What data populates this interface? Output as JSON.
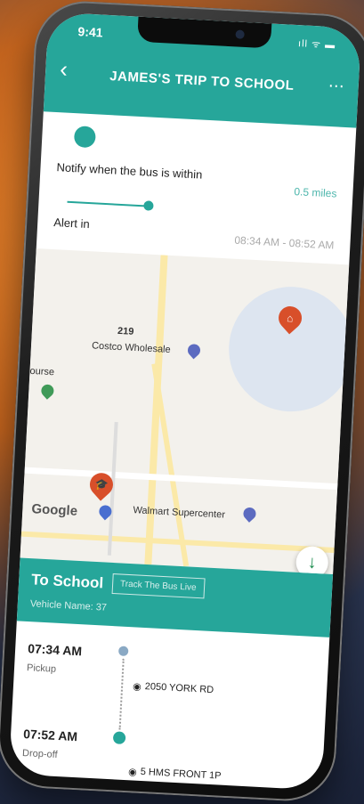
{
  "status": {
    "time": "9:41",
    "icons": "ıll ᯤ ▬"
  },
  "header": {
    "title": "JAMES'S TRIP TO SCHOOL",
    "back_icon": "back-arrow-icon",
    "more_icon": "more-icon"
  },
  "settings": {
    "notify_label": "Notify when the bus is within",
    "notify_value": "0.5 miles",
    "alert_label": "Alert in",
    "alert_value": "08:34 AM - 08:52 AM"
  },
  "map": {
    "labels": {
      "route_number": "219",
      "costco": "Costco Wholesale",
      "course": "ourse",
      "walmart": "Walmart Supercenter",
      "google": "Google"
    },
    "colors": {
      "home_pin": "#d84f2a",
      "school_pin": "#d84f2a",
      "poi": "#5c6bc0"
    }
  },
  "route": {
    "title": "To School",
    "track_button": "Track The Bus Live",
    "vehicle": "Vehicle Name: 37"
  },
  "stops": [
    {
      "time": "07:34 AM",
      "type": "Pickup",
      "address": "2050 YORK RD"
    },
    {
      "time": "07:52 AM",
      "type": "Drop-off",
      "address": "5 HMS FRONT 1P"
    }
  ]
}
